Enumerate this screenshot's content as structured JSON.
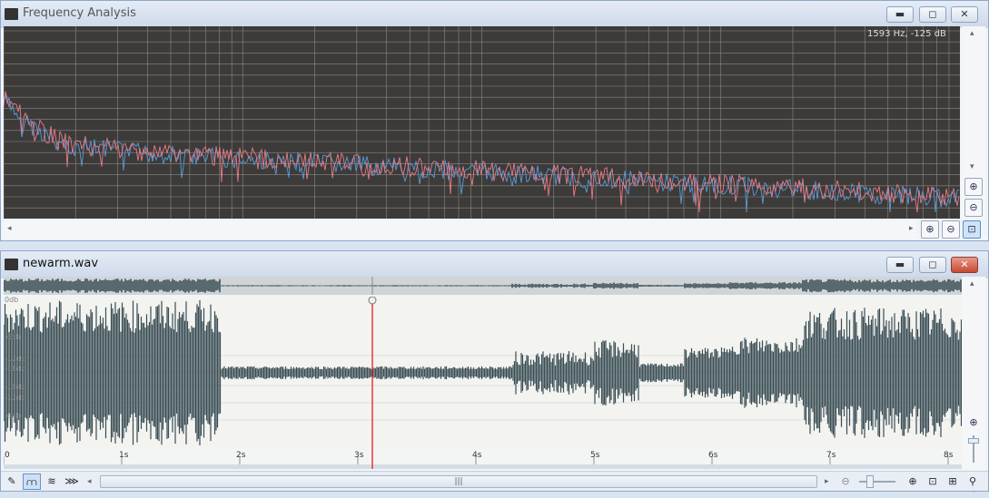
{
  "colors": {
    "spectrum_bg": "#3c3b39",
    "spectrum_grid": "#8b8a83",
    "series_left": "#e87b86",
    "series_right": "#5b9ad8",
    "waveform": "#3a4e55",
    "playhead": "#e02020"
  },
  "freq_window": {
    "title": "Frequency Analysis",
    "readout": "1593 Hz, -125 dB",
    "buttons": {
      "minimize": "▬",
      "maximize": "◻",
      "close": "✕"
    },
    "zoom_in": "⊕",
    "zoom_out": "⊖",
    "zoom_fit": "⊡"
  },
  "wave_window": {
    "title": "newarm.wav",
    "buttons": {
      "minimize": "▬",
      "maximize": "◻",
      "close": "✕"
    },
    "db_labels": [
      "0db",
      "-6db",
      "-12db",
      "-18db",
      "-18db",
      "-12db",
      "-6db"
    ],
    "time_ticks": [
      "0",
      "1s",
      "2s",
      "3s",
      "4s",
      "5s",
      "6s",
      "7s",
      "8s"
    ],
    "scroll_grip": "|||",
    "toolbar": {
      "pencil": "✎",
      "view_single": "⩋",
      "view_stereo": "≋",
      "view_multi": "⋙",
      "zoom_minus": "⊖",
      "zoom_plus": "⊕",
      "fit": "⊡",
      "zoom_sel": "⊞",
      "probe": "⚲"
    },
    "vzoom_in": "⊕",
    "vzoom_out": "⊖"
  }
}
